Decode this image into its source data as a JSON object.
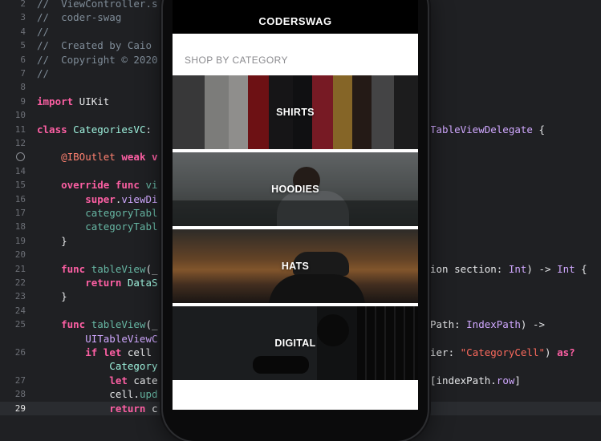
{
  "editor": {
    "lines": [
      {
        "n": "2",
        "code": [
          {
            "t": "//  ViewController.s",
            "c": "c-com"
          }
        ]
      },
      {
        "n": "3",
        "code": [
          {
            "t": "//  coder-swag",
            "c": "c-com"
          }
        ]
      },
      {
        "n": "4",
        "code": [
          {
            "t": "//",
            "c": "c-com"
          }
        ]
      },
      {
        "n": "5",
        "code": [
          {
            "t": "//  Created by Caio",
            "c": "c-com"
          }
        ]
      },
      {
        "n": "6",
        "code": [
          {
            "t": "//  Copyright © 2020",
            "c": "c-com"
          }
        ]
      },
      {
        "n": "7",
        "code": [
          {
            "t": "//",
            "c": "c-com"
          }
        ]
      },
      {
        "n": "8",
        "code": []
      },
      {
        "n": "9",
        "code": [
          {
            "t": "import",
            "c": "c-kw"
          },
          {
            "t": " UIKit",
            "c": "c-plain"
          }
        ]
      },
      {
        "n": "10",
        "code": []
      },
      {
        "n": "11",
        "code": [
          {
            "t": "class",
            "c": "c-kw"
          },
          {
            "t": " ",
            "c": "c-plain"
          },
          {
            "t": "CategoriesVC",
            "c": "c-type"
          },
          {
            "t": ":",
            "c": "c-plain"
          }
        ],
        "right": [
          {
            "t": "TableViewDelegate",
            "c": "c-sys"
          },
          {
            "t": " {",
            "c": "c-plain"
          }
        ]
      },
      {
        "n": "12",
        "code": []
      },
      {
        "n": "",
        "bp": true,
        "code": [
          {
            "t": "    @IBOutlet",
            "c": "c-attr"
          },
          {
            "t": " ",
            "c": "c-plain"
          },
          {
            "t": "weak",
            "c": "c-kw"
          },
          {
            "t": " v",
            "c": "c-kw"
          }
        ]
      },
      {
        "n": "14",
        "code": []
      },
      {
        "n": "15",
        "code": [
          {
            "t": "    override",
            "c": "c-kw"
          },
          {
            "t": " ",
            "c": "c-plain"
          },
          {
            "t": "func",
            "c": "c-kw"
          },
          {
            "t": " vi",
            "c": "c-fn"
          }
        ]
      },
      {
        "n": "16",
        "code": [
          {
            "t": "        super",
            "c": "c-kw"
          },
          {
            "t": ".",
            "c": "c-plain"
          },
          {
            "t": "viewDi",
            "c": "c-sys"
          }
        ]
      },
      {
        "n": "17",
        "code": [
          {
            "t": "        categoryTabl",
            "c": "c-fn"
          }
        ]
      },
      {
        "n": "18",
        "code": [
          {
            "t": "        categoryTabl",
            "c": "c-fn"
          }
        ]
      },
      {
        "n": "19",
        "code": [
          {
            "t": "    }",
            "c": "c-plain"
          }
        ]
      },
      {
        "n": "20",
        "code": []
      },
      {
        "n": "21",
        "code": [
          {
            "t": "    func",
            "c": "c-kw"
          },
          {
            "t": " ",
            "c": "c-plain"
          },
          {
            "t": "tableView",
            "c": "c-fn"
          },
          {
            "t": "(_",
            "c": "c-plain"
          }
        ],
        "right": [
          {
            "t": "ion section: ",
            "c": "c-plain"
          },
          {
            "t": "Int",
            "c": "c-sys"
          },
          {
            "t": ") -> ",
            "c": "c-plain"
          },
          {
            "t": "Int",
            "c": "c-sys"
          },
          {
            "t": " {",
            "c": "c-plain"
          }
        ]
      },
      {
        "n": "22",
        "code": [
          {
            "t": "        return",
            "c": "c-kw"
          },
          {
            "t": " DataS",
            "c": "c-type"
          }
        ]
      },
      {
        "n": "23",
        "code": [
          {
            "t": "    }",
            "c": "c-plain"
          }
        ]
      },
      {
        "n": "24",
        "code": []
      },
      {
        "n": "25",
        "code": [
          {
            "t": "    func",
            "c": "c-kw"
          },
          {
            "t": " ",
            "c": "c-plain"
          },
          {
            "t": "tableView",
            "c": "c-fn"
          },
          {
            "t": "(_",
            "c": "c-plain"
          }
        ],
        "right": [
          {
            "t": "Path: ",
            "c": "c-plain"
          },
          {
            "t": "IndexPath",
            "c": "c-sys"
          },
          {
            "t": ") ->",
            "c": "c-plain"
          }
        ]
      },
      {
        "n": "",
        "code": [
          {
            "t": "        UITableViewC",
            "c": "c-sys"
          }
        ]
      },
      {
        "n": "26",
        "code": [
          {
            "t": "        if",
            "c": "c-kw"
          },
          {
            "t": " ",
            "c": "c-plain"
          },
          {
            "t": "let",
            "c": "c-kw"
          },
          {
            "t": " cell",
            "c": "c-plain"
          }
        ],
        "right": [
          {
            "t": "ier: ",
            "c": "c-plain"
          },
          {
            "t": "\"CategoryCell\"",
            "c": "c-str"
          },
          {
            "t": ") ",
            "c": "c-plain"
          },
          {
            "t": "as?",
            "c": "c-kw"
          }
        ]
      },
      {
        "n": "",
        "code": [
          {
            "t": "            Category",
            "c": "c-type"
          }
        ]
      },
      {
        "n": "27",
        "code": [
          {
            "t": "            let",
            "c": "c-kw"
          },
          {
            "t": " cate",
            "c": "c-plain"
          }
        ],
        "right": [
          {
            "t": "[indexPath.",
            "c": "c-plain"
          },
          {
            "t": "row",
            "c": "c-sys"
          },
          {
            "t": "]",
            "c": "c-plain"
          }
        ]
      },
      {
        "n": "28",
        "code": [
          {
            "t": "            cell.",
            "c": "c-plain"
          },
          {
            "t": "upd",
            "c": "c-fn"
          }
        ]
      },
      {
        "n": "29",
        "active": true,
        "code": [
          {
            "t": "            return",
            "c": "c-kw"
          },
          {
            "t": " c",
            "c": "c-plain"
          }
        ]
      }
    ]
  },
  "app": {
    "nav_title": "CODERSWAG",
    "section_header": "SHOP BY CATEGORY",
    "categories": [
      {
        "label": "SHIRTS"
      },
      {
        "label": "HOODIES"
      },
      {
        "label": "HATS"
      },
      {
        "label": "DIGITAL"
      }
    ]
  }
}
